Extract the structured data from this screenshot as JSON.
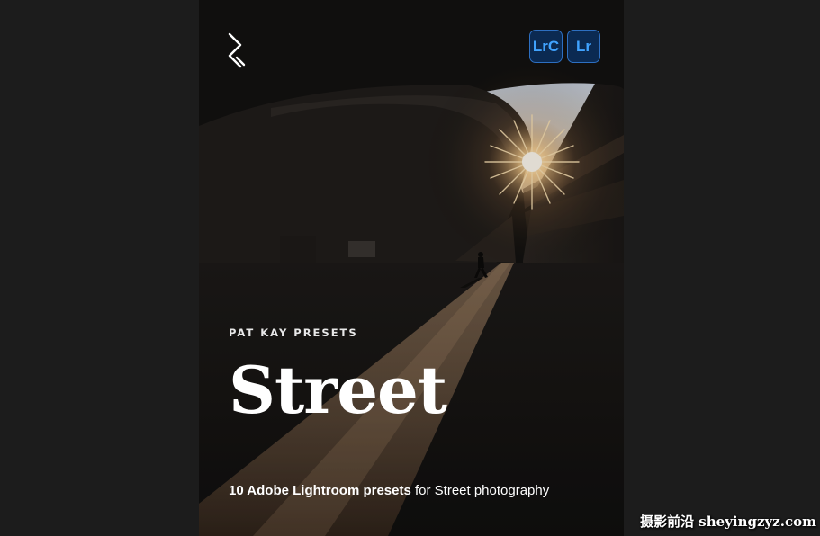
{
  "poster": {
    "brand": "PAT KAY PRESETS",
    "title": "Street",
    "subtitle_bold": "10 Adobe Lightroom presets",
    "subtitle_rest": " for Street photography",
    "badges": [
      "LrC",
      "Lr"
    ],
    "logo_icon": "zigzag-logo-icon"
  },
  "watermark": "摄影前沿 sheyingzyz.com",
  "colors": {
    "background": "#1c1c1c",
    "badge_fill": "#0b2a52",
    "badge_text": "#40a3ff",
    "text": "#ffffff"
  }
}
